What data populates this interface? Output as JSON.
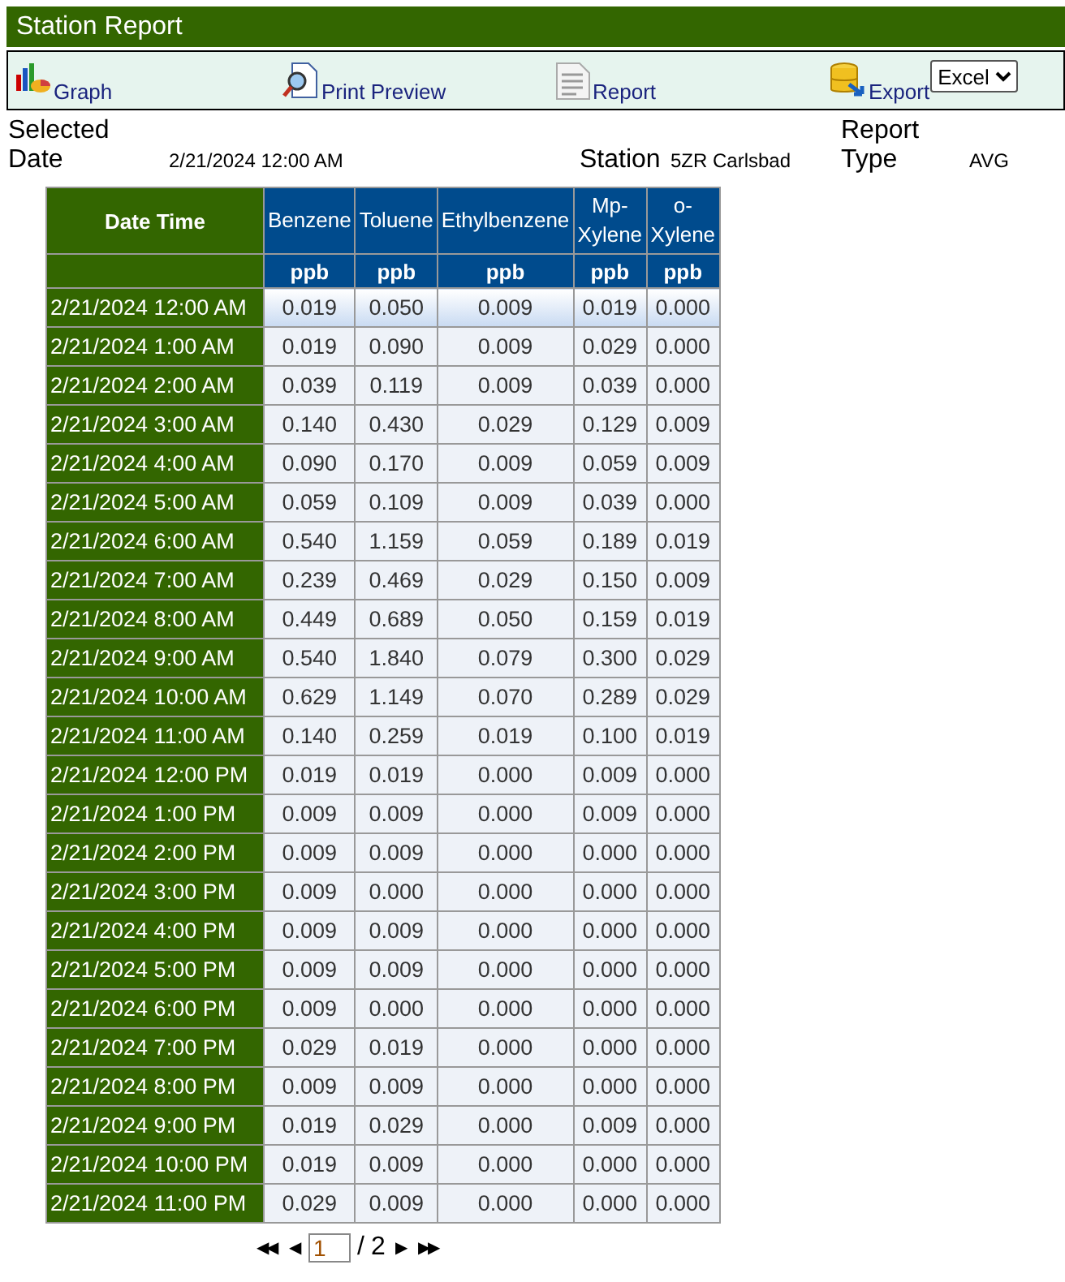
{
  "window": {
    "title": "Station Report"
  },
  "toolbar": [
    {
      "kind": "graph",
      "label": "Graph"
    },
    {
      "kind": "preview",
      "label": "Print Preview"
    },
    {
      "kind": "report",
      "label": "Report"
    },
    {
      "kind": "export",
      "label": "Export"
    }
  ],
  "export_format": {
    "value": "Excel"
  },
  "info": {
    "date_label": "Selected Date",
    "date": "2/21/2024 12:00 AM",
    "station_label": "Station",
    "station": "5ZR Carlsbad",
    "type_label": "Report Type",
    "type": "AVG"
  },
  "table": {
    "date_column": "Date Time",
    "columns": [
      {
        "name": "Benzene",
        "unit": "ppb"
      },
      {
        "name": "Toluene",
        "unit": "ppb"
      },
      {
        "name": "Ethylbenzene",
        "unit": "ppb"
      },
      {
        "name": "Mp-Xylene",
        "unit": "ppb"
      },
      {
        "name": "o-Xylene",
        "unit": "ppb"
      }
    ],
    "rows": [
      {
        "time": "2/21/2024 12:00 AM",
        "values": [
          "0.019",
          "0.050",
          "0.009",
          "0.019",
          "0.000"
        ],
        "selected": true
      },
      {
        "time": "2/21/2024 1:00 AM",
        "values": [
          "0.019",
          "0.090",
          "0.009",
          "0.029",
          "0.000"
        ],
        "selected": false
      },
      {
        "time": "2/21/2024 2:00 AM",
        "values": [
          "0.039",
          "0.119",
          "0.009",
          "0.039",
          "0.000"
        ],
        "selected": false
      },
      {
        "time": "2/21/2024 3:00 AM",
        "values": [
          "0.140",
          "0.430",
          "0.029",
          "0.129",
          "0.009"
        ],
        "selected": false
      },
      {
        "time": "2/21/2024 4:00 AM",
        "values": [
          "0.090",
          "0.170",
          "0.009",
          "0.059",
          "0.009"
        ],
        "selected": false
      },
      {
        "time": "2/21/2024 5:00 AM",
        "values": [
          "0.059",
          "0.109",
          "0.009",
          "0.039",
          "0.000"
        ],
        "selected": false
      },
      {
        "time": "2/21/2024 6:00 AM",
        "values": [
          "0.540",
          "1.159",
          "0.059",
          "0.189",
          "0.019"
        ],
        "selected": false
      },
      {
        "time": "2/21/2024 7:00 AM",
        "values": [
          "0.239",
          "0.469",
          "0.029",
          "0.150",
          "0.009"
        ],
        "selected": false
      },
      {
        "time": "2/21/2024 8:00 AM",
        "values": [
          "0.449",
          "0.689",
          "0.050",
          "0.159",
          "0.019"
        ],
        "selected": false
      },
      {
        "time": "2/21/2024 9:00 AM",
        "values": [
          "0.540",
          "1.840",
          "0.079",
          "0.300",
          "0.029"
        ],
        "selected": false
      },
      {
        "time": "2/21/2024 10:00 AM",
        "values": [
          "0.629",
          "1.149",
          "0.070",
          "0.289",
          "0.029"
        ],
        "selected": false
      },
      {
        "time": "2/21/2024 11:00 AM",
        "values": [
          "0.140",
          "0.259",
          "0.019",
          "0.100",
          "0.019"
        ],
        "selected": false
      },
      {
        "time": "2/21/2024 12:00 PM",
        "values": [
          "0.019",
          "0.019",
          "0.000",
          "0.009",
          "0.000"
        ],
        "selected": false
      },
      {
        "time": "2/21/2024 1:00 PM",
        "values": [
          "0.009",
          "0.009",
          "0.000",
          "0.009",
          "0.000"
        ],
        "selected": false
      },
      {
        "time": "2/21/2024 2:00 PM",
        "values": [
          "0.009",
          "0.009",
          "0.000",
          "0.000",
          "0.000"
        ],
        "selected": false
      },
      {
        "time": "2/21/2024 3:00 PM",
        "values": [
          "0.009",
          "0.000",
          "0.000",
          "0.000",
          "0.000"
        ],
        "selected": false
      },
      {
        "time": "2/21/2024 4:00 PM",
        "values": [
          "0.009",
          "0.009",
          "0.000",
          "0.000",
          "0.000"
        ],
        "selected": false
      },
      {
        "time": "2/21/2024 5:00 PM",
        "values": [
          "0.009",
          "0.009",
          "0.000",
          "0.000",
          "0.000"
        ],
        "selected": false
      },
      {
        "time": "2/21/2024 6:00 PM",
        "values": [
          "0.009",
          "0.000",
          "0.000",
          "0.000",
          "0.000"
        ],
        "selected": false
      },
      {
        "time": "2/21/2024 7:00 PM",
        "values": [
          "0.029",
          "0.019",
          "0.000",
          "0.000",
          "0.000"
        ],
        "selected": false
      },
      {
        "time": "2/21/2024 8:00 PM",
        "values": [
          "0.009",
          "0.009",
          "0.000",
          "0.000",
          "0.000"
        ],
        "selected": false
      },
      {
        "time": "2/21/2024 9:00 PM",
        "values": [
          "0.019",
          "0.029",
          "0.000",
          "0.009",
          "0.000"
        ],
        "selected": false
      },
      {
        "time": "2/21/2024 10:00 PM",
        "values": [
          "0.019",
          "0.009",
          "0.000",
          "0.000",
          "0.000"
        ],
        "selected": false
      },
      {
        "time": "2/21/2024 11:00 PM",
        "values": [
          "0.029",
          "0.009",
          "0.000",
          "0.000",
          "0.000"
        ],
        "selected": false
      }
    ]
  },
  "pager": {
    "first": "◀◀",
    "prev": "◀",
    "page": "1",
    "separator": "/",
    "total": "2",
    "next": "▶",
    "last": "▶▶"
  }
}
